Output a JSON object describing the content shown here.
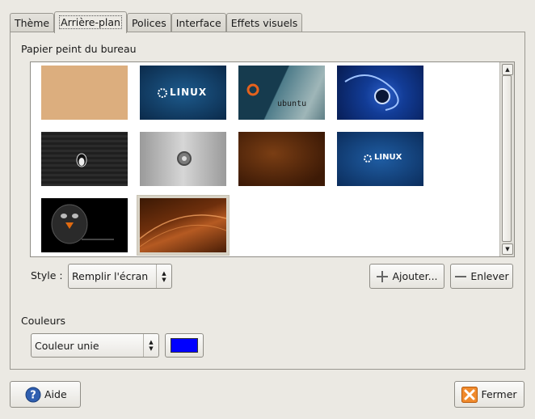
{
  "tabs": [
    {
      "label": "Thème"
    },
    {
      "label": "Arrière-plan"
    },
    {
      "label": "Polices"
    },
    {
      "label": "Interface"
    },
    {
      "label": "Effets visuels"
    }
  ],
  "wallpaper": {
    "section_label": "Papier peint du bureau",
    "thumbnails": [
      {
        "text": ""
      },
      {
        "text": "LINUX"
      },
      {
        "text": "ubuntu"
      },
      {
        "text": ""
      },
      {
        "text": ""
      },
      {
        "text": ""
      },
      {
        "text": ""
      },
      {
        "text": "LINUX"
      },
      {
        "text": ""
      },
      {
        "text": ""
      }
    ],
    "style_label": "Style :",
    "style_value": "Remplir l'écran",
    "add_button": "Ajouter...",
    "remove_button": "Enlever"
  },
  "colors": {
    "section_label": "Couleurs",
    "mode_value": "Couleur unie",
    "swatch_color": "#0000ff"
  },
  "footer": {
    "help_button": "Aide",
    "close_button": "Fermer"
  }
}
